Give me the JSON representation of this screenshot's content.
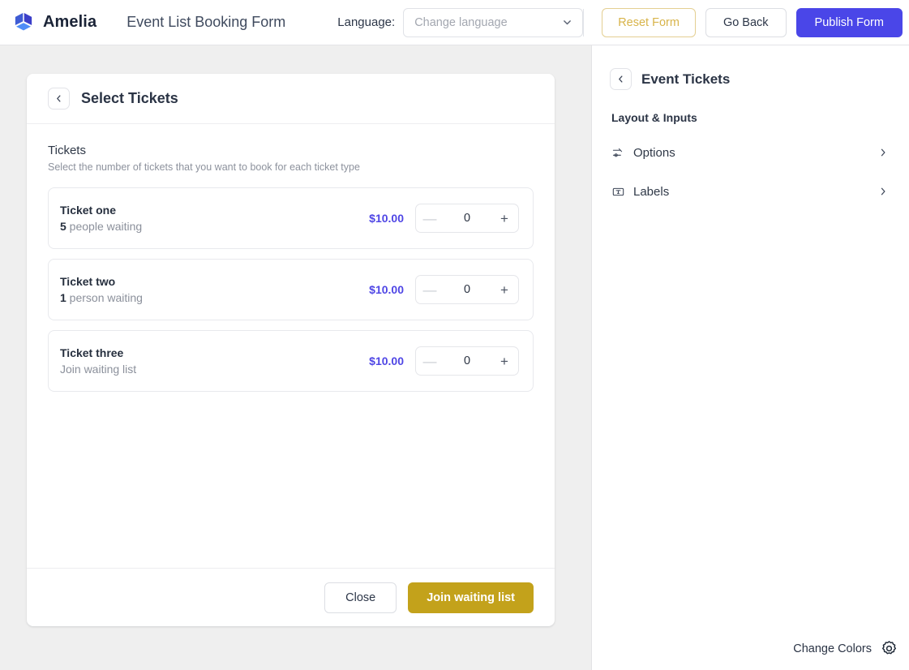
{
  "header": {
    "brand": "Amelia",
    "form_title": "Event List Booking Form",
    "language_label": "Language:",
    "language_placeholder": "Change language",
    "reset_label": "Reset Form",
    "go_back_label": "Go Back",
    "publish_label": "Publish Form",
    "accent_publish": "#4a46e8",
    "accent_reset": "#d8b44a"
  },
  "preview": {
    "title": "Select Tickets",
    "section_title": "Tickets",
    "section_subtitle": "Select the number of tickets that you want to book for each ticket type",
    "tickets": [
      {
        "name": "Ticket one",
        "waiting_count": "5",
        "waiting_text": " people waiting",
        "price": "$10.00",
        "quantity": "0",
        "minus": "—",
        "plus": "+"
      },
      {
        "name": "Ticket two",
        "waiting_count": "1",
        "waiting_text": " person waiting",
        "price": "$10.00",
        "quantity": "0",
        "minus": "—",
        "plus": "+"
      },
      {
        "name": "Ticket three",
        "waiting_count": "",
        "waiting_text": "Join waiting list",
        "price": "$10.00",
        "quantity": "0",
        "minus": "—",
        "plus": "+"
      }
    ],
    "close_label": "Close",
    "join_label": "Join waiting list",
    "join_color": "#c3a21b",
    "price_color": "#4f46e5"
  },
  "sidebar": {
    "title": "Event Tickets",
    "group_label": "Layout & Inputs",
    "items": [
      {
        "label": "Options",
        "icon": "sliders-icon"
      },
      {
        "label": "Labels",
        "icon": "text-box-icon"
      }
    ],
    "change_colors_label": "Change Colors"
  },
  "icons": {
    "back": "chevron-left-icon",
    "dropdown": "chevron-down-icon",
    "row_arrow": "chevron-right-icon",
    "settings": "gear-icon",
    "logo": "amelia-cube-logo"
  }
}
